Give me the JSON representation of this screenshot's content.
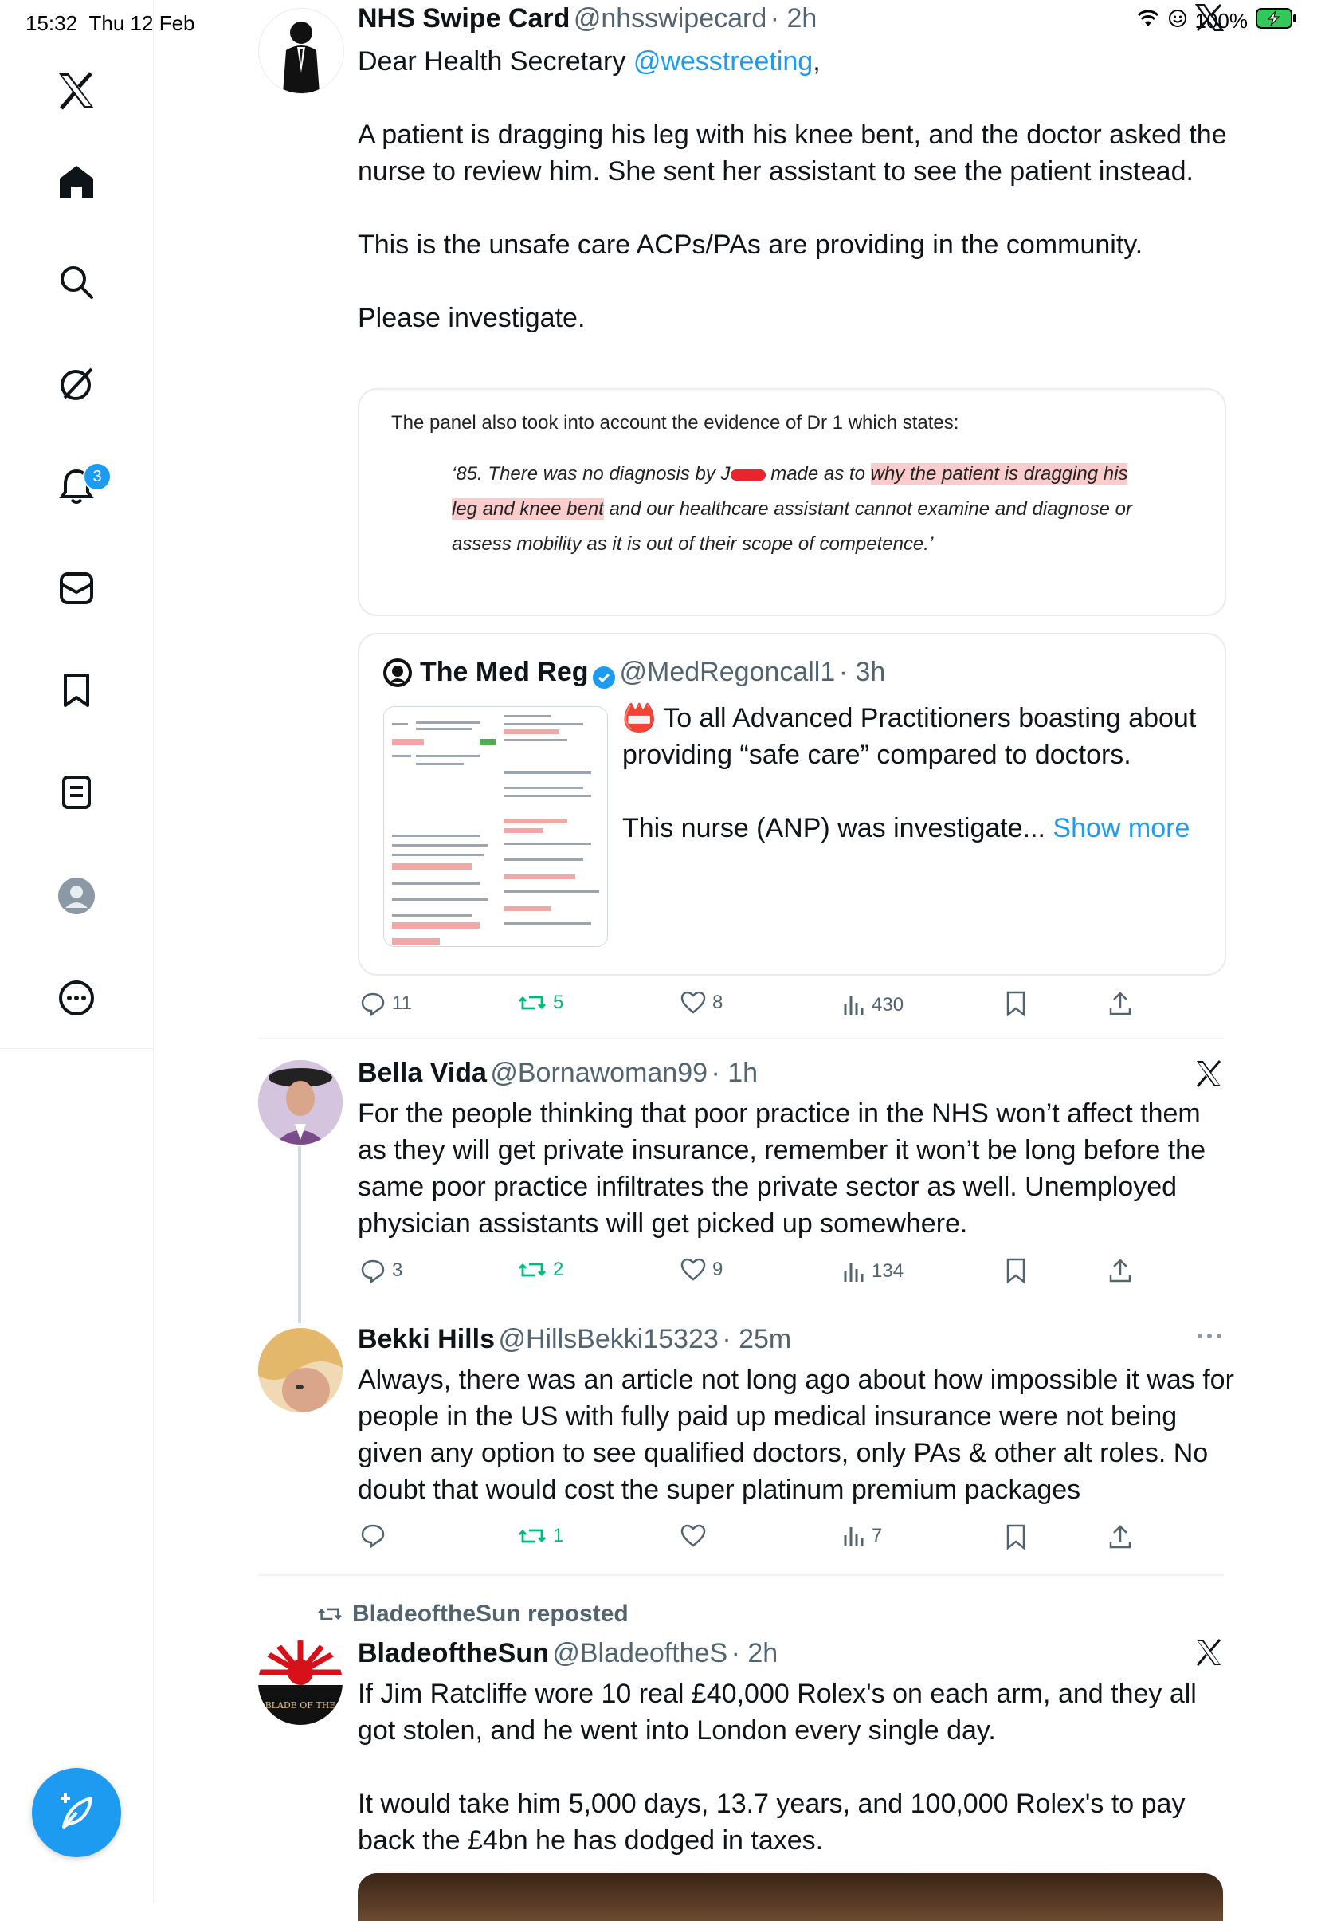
{
  "status_bar": {
    "time": "15:32",
    "date": "Thu 12 Feb",
    "battery": "100%"
  },
  "sidebar": {
    "items": [
      {
        "name": "x-logo-icon"
      },
      {
        "name": "home-icon"
      },
      {
        "name": "search-icon"
      },
      {
        "name": "grok-icon"
      },
      {
        "name": "notifications-icon"
      },
      {
        "name": "messages-icon"
      },
      {
        "name": "bookmarks-icon"
      },
      {
        "name": "lists-icon"
      },
      {
        "name": "profile-icon"
      },
      {
        "name": "more-icon"
      }
    ],
    "notification_count": "3"
  },
  "tweet1": {
    "name": "NHS Swipe Card",
    "handle": "@nhsswipecard",
    "time": "· 2h",
    "greeting_prefix": "Dear Health Secretary ",
    "mention": "@wesstreeting",
    "greeting_suffix": ",",
    "text": "A patient is dragging his leg with his knee bent, and the doctor asked the nurse to review him. She sent her assistant to see the patient instead.\n\nThis is the unsafe care ACPs/PAs are providing in the community.\n\nPlease investigate.",
    "document": {
      "line1": "The panel also took into account the evidence of Dr 1 which states:",
      "quote_a": "‘85. There was no diagnosis by J",
      "quote_b": " made as to ",
      "quote_hl1": "why the patient is dragging his",
      "quote_hl2": "leg and knee bent",
      "quote_c": " and our healthcare assistant cannot examine and diagnose or",
      "quote_d": "assess mobility as it is out of their scope of competence.’"
    },
    "quoted": {
      "name": "The Med Reg",
      "handle": "@MedRegoncall1",
      "time": "· 3h",
      "emoji": "📛",
      "text": "To all Advanced Practitioners boasting about providing “safe care” compared to doctors.\n\nThis nurse (ANP) was investigate...",
      "show_more": "Show more"
    },
    "actions": {
      "replies": "11",
      "reposts": "5",
      "likes": "8",
      "views": "430"
    }
  },
  "tweet2": {
    "name": "Bella Vida",
    "handle": "@Bornawoman99",
    "time": "· 1h",
    "text": "For the people thinking that poor practice in the NHS won’t affect them as they will get private insurance, remember it won’t be long before the same poor practice infiltrates the private sector as well. Unemployed physician assistants will get picked up somewhere.",
    "actions": {
      "replies": "3",
      "reposts": "2",
      "likes": "9",
      "views": "134"
    }
  },
  "tweet3": {
    "name": "Bekki Hills",
    "handle": "@HillsBekki15323",
    "time": "· 25m",
    "text": "Always, there was an article not long ago about how impossible it was for people in the US with fully paid up medical insurance were not being given any option to see qualified doctors, only PAs & other alt roles. No doubt that would cost the super platinum premium packages",
    "actions": {
      "replies": "",
      "reposts": "1",
      "likes": "",
      "views": "7"
    }
  },
  "tweet4": {
    "repost_label": "BladeoftheSun reposted",
    "name": "BladeoftheSun",
    "handle": "@BladeoftheS",
    "time": "· 2h",
    "avatar_text": "BLADE OF THE",
    "text": "If Jim Ratcliffe wore 10 real £40,000 Rolex's on each arm, and they all got stolen, and he went into London every single day.\n\nIt would take him 5,000 days, 13.7 years, and 100,000 Rolex's to pay back the £4bn he has dodged in taxes."
  },
  "colors": {
    "accent": "#1d9bf0",
    "repost_green": "#00ba7c",
    "secondary": "#536471"
  }
}
